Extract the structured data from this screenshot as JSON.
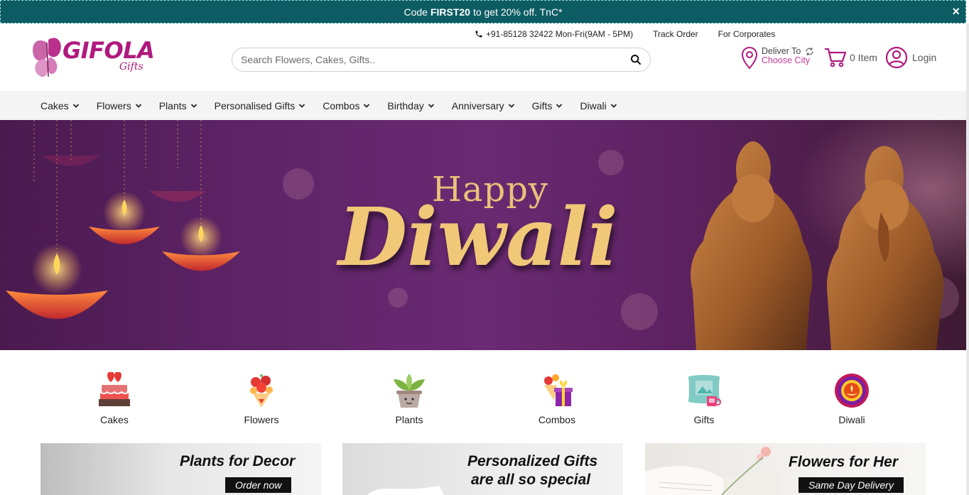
{
  "promo": {
    "prefix": "Code",
    "code": "FIRST20",
    "suffix": "to get 20% off. TnC*",
    "close": "×"
  },
  "header": {
    "logo_text": "GIFOLA",
    "logo_sub": "Gifts",
    "phone": "+91-85128 32422 Mon-Fri(9AM - 5PM)",
    "track_order": "Track Order",
    "for_corporates": "For Corporates",
    "search_placeholder": "Search Flowers, Cakes, Gifts..",
    "deliver_to": "Deliver To",
    "choose_city": "Choose City",
    "cart_label": "0 Item",
    "login_label": "Login"
  },
  "nav": {
    "items": [
      "Cakes",
      "Flowers",
      "Plants",
      "Personalised Gifts",
      "Combos",
      "Birthday",
      "Anniversary",
      "Gifts",
      "Diwali"
    ]
  },
  "hero": {
    "line1": "Happy",
    "line2": "Diwali"
  },
  "categories": [
    {
      "label": "Cakes",
      "icon": "cake-icon"
    },
    {
      "label": "Flowers",
      "icon": "bouquet-icon"
    },
    {
      "label": "Plants",
      "icon": "potted-plant-icon"
    },
    {
      "label": "Combos",
      "icon": "gift-combo-icon"
    },
    {
      "label": "Gifts",
      "icon": "photo-cushion-icon"
    },
    {
      "label": "Diwali",
      "icon": "rangoli-icon"
    }
  ],
  "cards": [
    {
      "title": "Plants for Decor",
      "cta": "Order now"
    },
    {
      "title_line1": "Personalized Gifts",
      "title_line2": "are all so special"
    },
    {
      "title": "Flowers for Her",
      "cta": "Same Day Delivery"
    }
  ],
  "colors": {
    "promo_bg": "#0d5c63",
    "brand": "#b0197e",
    "accent_city": "#c33c96",
    "hero_bg": "#5d2366",
    "hero_text": "#f0c878"
  }
}
